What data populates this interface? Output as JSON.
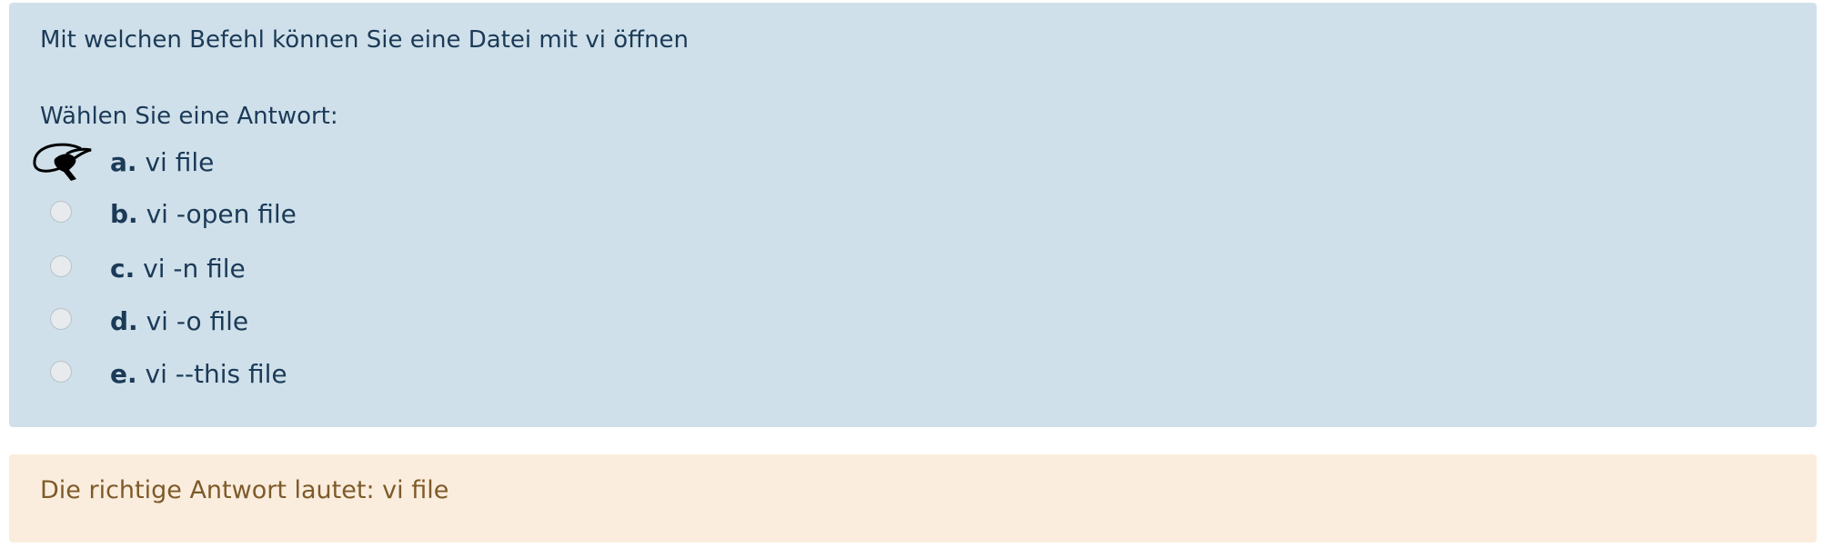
{
  "question": {
    "text": "Mit welchen Befehl können Sie eine Datei mit vi öffnen",
    "prompt": "Wählen Sie eine Antwort:",
    "answers": [
      {
        "letter": "a.",
        "text": "vi file",
        "selected": true
      },
      {
        "letter": "b.",
        "text": "vi -open file",
        "selected": false
      },
      {
        "letter": "c.",
        "text": "vi -n file",
        "selected": false
      },
      {
        "letter": "d.",
        "text": "vi -o file",
        "selected": false
      },
      {
        "letter": "e.",
        "text": "vi --this file",
        "selected": false
      }
    ]
  },
  "feedback": {
    "text": "Die richtige Antwort lautet: vi file"
  },
  "colors": {
    "question_bg": "#cfe0ea",
    "feedback_bg": "#fbeddd",
    "text": "#1b3a57",
    "feedback_text": "#7d5a2a"
  }
}
